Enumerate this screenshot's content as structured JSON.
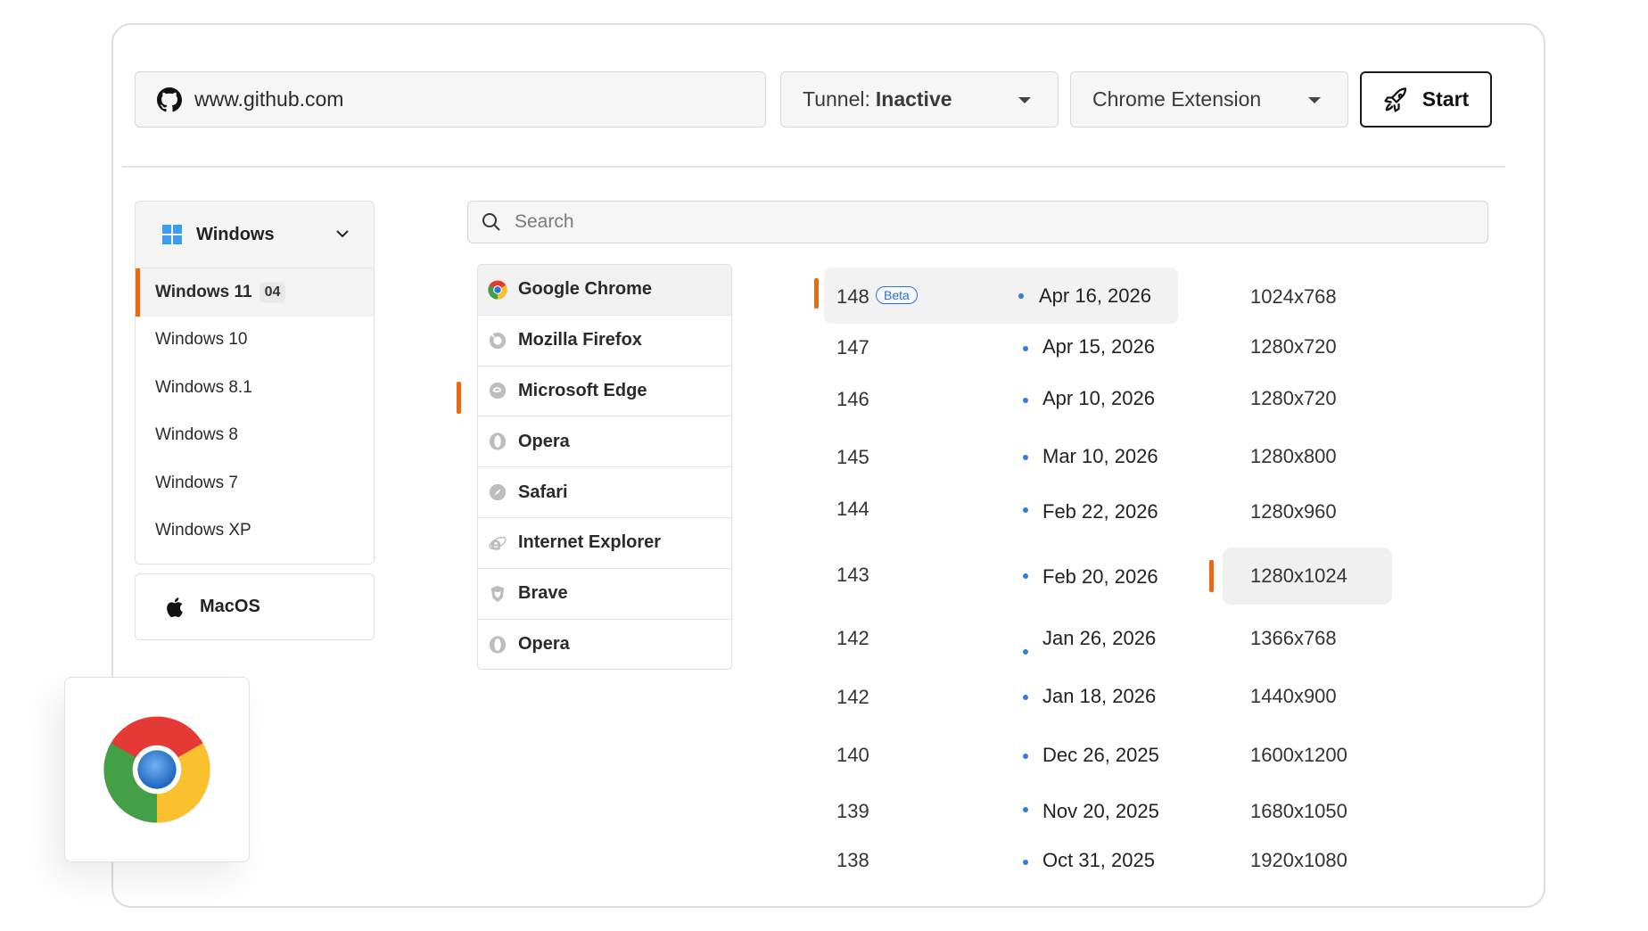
{
  "top_bar": {
    "url": "www.github.com",
    "tunnel_label": "Tunnel:",
    "tunnel_status": "Inactive",
    "extension": "Chrome Extension",
    "start_label": "Start"
  },
  "os_panel": {
    "windows_label": "Windows",
    "items": [
      {
        "label": "Windows 11",
        "badge": "04"
      },
      {
        "label": "Windows 10"
      },
      {
        "label": "Windows 8.1"
      },
      {
        "label": "Windows 8"
      },
      {
        "label": "Windows 7"
      },
      {
        "label": "Windows XP"
      }
    ],
    "mac_label": "MacOS"
  },
  "search": {
    "placeholder": "Search"
  },
  "browsers": [
    {
      "label": "Google Chrome",
      "icon": "chrome-icon"
    },
    {
      "label": "Mozilla Firefox",
      "icon": "firefox-icon"
    },
    {
      "label": "Microsoft Edge",
      "icon": "edge-icon"
    },
    {
      "label": "Opera",
      "icon": "opera-icon"
    },
    {
      "label": "Safari",
      "icon": "safari-icon"
    },
    {
      "label": "Internet Explorer",
      "icon": "ie-icon"
    },
    {
      "label": "Brave",
      "icon": "brave-icon"
    },
    {
      "label": "Opera",
      "icon": "opera-icon"
    }
  ],
  "versions": [
    {
      "num": "148",
      "beta": "Beta",
      "date": "Apr 16, 2026"
    },
    {
      "num": "147",
      "date": "Apr 15, 2026"
    },
    {
      "num": "146",
      "date": "Apr 10, 2026"
    },
    {
      "num": "145",
      "date": "Mar 10, 2026"
    },
    {
      "num": "144",
      "date": "Feb 22, 2026"
    },
    {
      "num": "143",
      "date": "Feb 20, 2026"
    },
    {
      "num": "142",
      "date": "Jan 26, 2026"
    },
    {
      "num": "142",
      "date": "Jan 18, 2026"
    },
    {
      "num": "140",
      "date": "Dec 26, 2025"
    },
    {
      "num": "139",
      "date": "Nov 20, 2025"
    },
    {
      "num": "138",
      "date": "Oct 31, 2025"
    }
  ],
  "resolutions": [
    "1024x768",
    "1280x720",
    "1280x720",
    "1280x800",
    "1280x960",
    "1280x1024",
    "1366x768",
    "1440x900",
    "1600x1200",
    "1680x1050",
    "1920x1080"
  ],
  "colors": {
    "accent": "#ea6a12",
    "link_blue": "#2f6fd8"
  }
}
